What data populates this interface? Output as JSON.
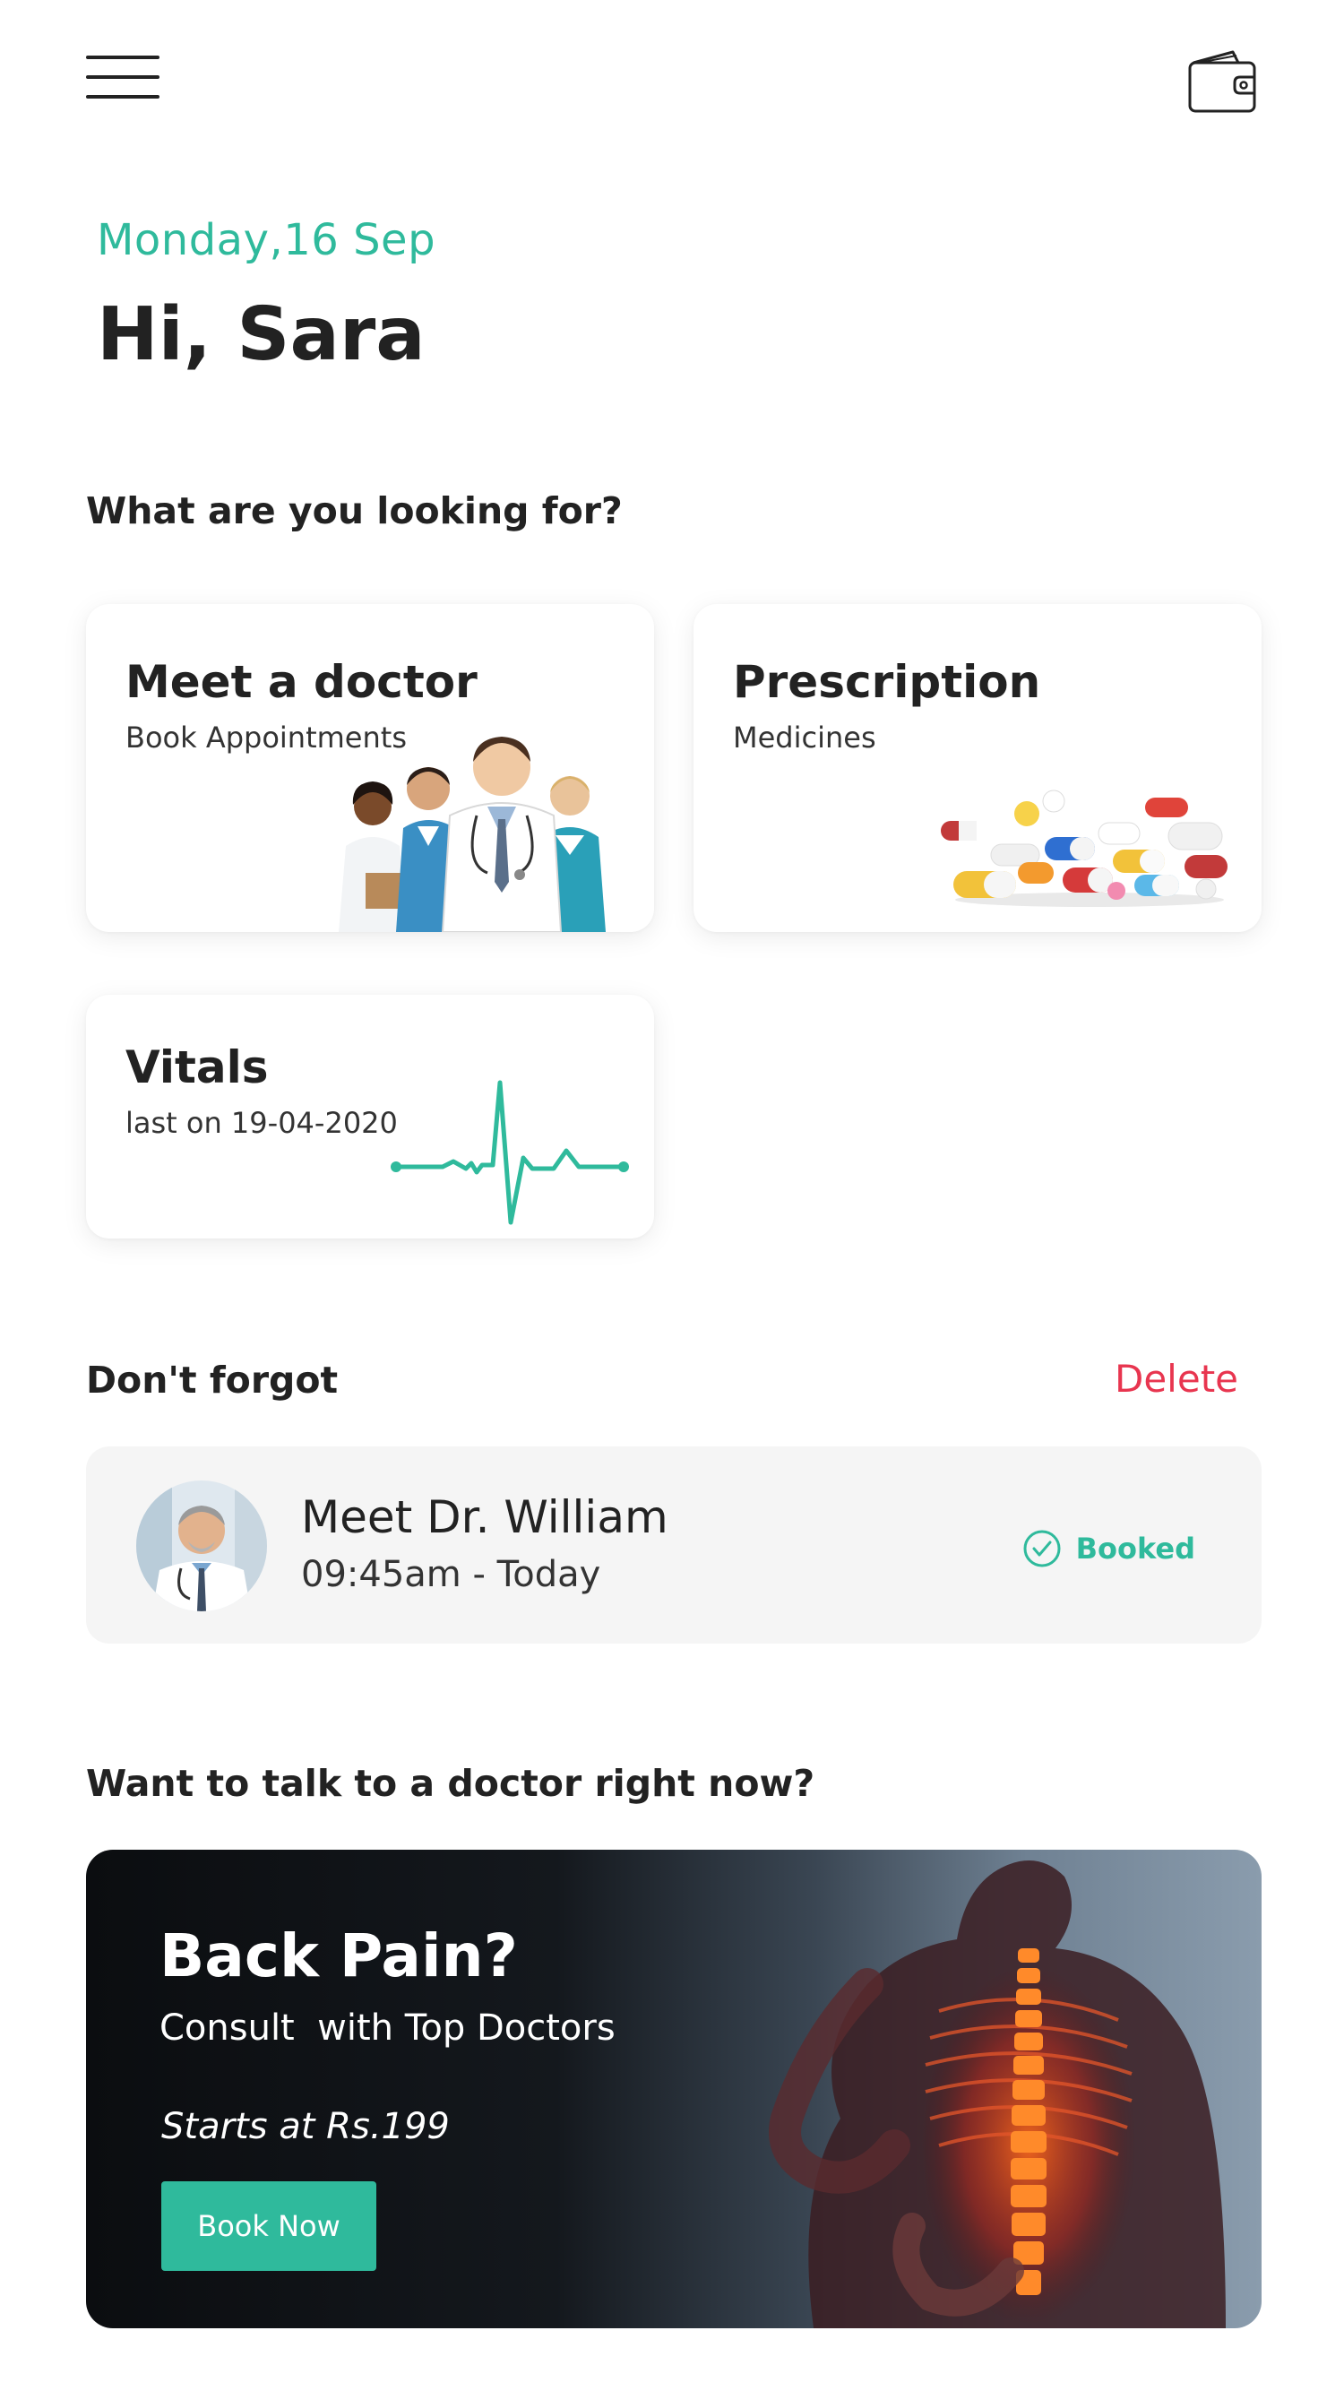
{
  "header": {
    "menu_icon": "hamburger-menu-icon",
    "wallet_icon": "wallet-icon"
  },
  "greeting": {
    "date": "Monday,16 Sep",
    "title": "Hi, Sara"
  },
  "looking_for": {
    "title": "What are you looking for?",
    "cards": [
      {
        "title": "Meet a doctor",
        "subtitle": "Book Appointments",
        "image": "doctors-group-photo"
      },
      {
        "title": "Prescription",
        "subtitle": "Medicines",
        "image": "pills-photo"
      },
      {
        "title": "Vitals",
        "subtitle": "last on 19-04-2020",
        "image": "heartbeat-line"
      }
    ]
  },
  "reminders": {
    "title": "Don't forgot",
    "delete_label": "Delete",
    "appointment": {
      "title": "Meet Dr. William",
      "time": "09:45am - Today",
      "status": "Booked",
      "status_icon": "check-circle-icon"
    }
  },
  "consult": {
    "title": "Want to talk to a doctor right now?",
    "banner": {
      "title": "Back Pain?",
      "subtitle": "Consult  with Top Doctors",
      "price": "Starts at Rs.199",
      "button_label": "Book Now"
    }
  },
  "colors": {
    "accent": "#2fba9c",
    "danger": "#e8354f",
    "text": "#222222"
  }
}
